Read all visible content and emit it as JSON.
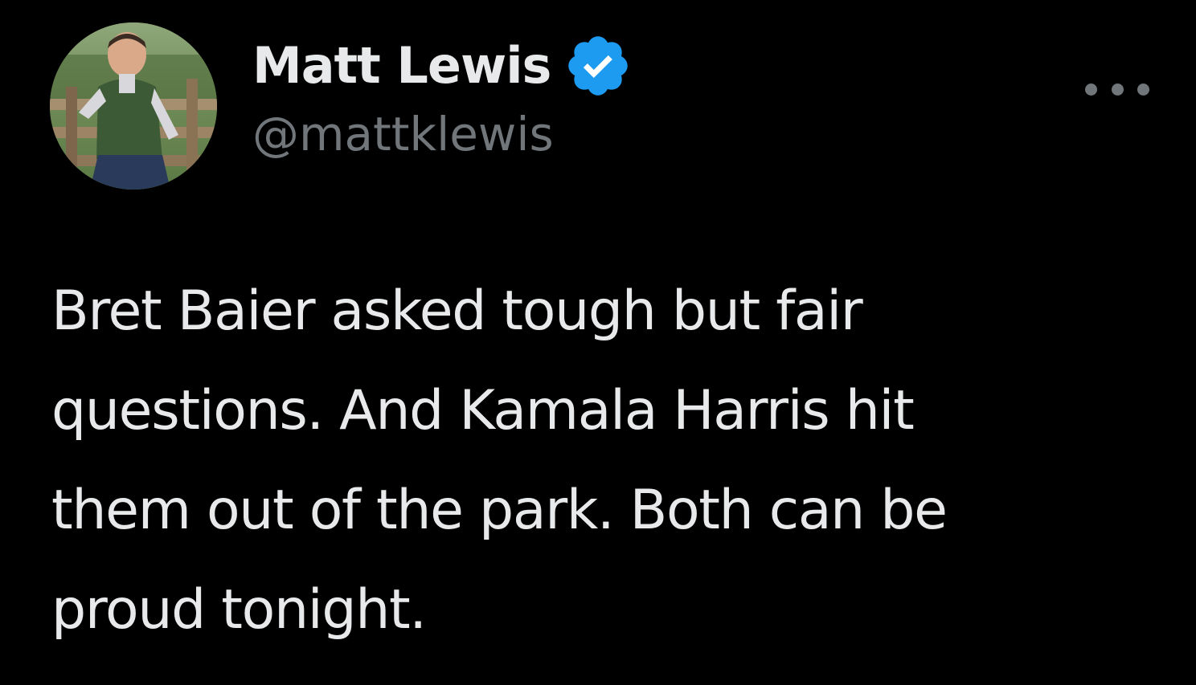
{
  "author": {
    "display_name": "Matt Lewis",
    "handle": "@mattklewis",
    "verified": true,
    "avatar_icon": "profile-photo",
    "badge_icon": "verified-checkmark-icon",
    "badge_color": "#1d9bf0"
  },
  "tweet": {
    "text_lines": [
      "Bret Baier asked tough but fair",
      "questions. And Kamala Harris hit",
      "them out of the park. Both can be",
      "proud tonight."
    ]
  },
  "actions": {
    "more_icon": "more-options-icon"
  },
  "colors": {
    "background": "#000000",
    "text_primary": "#e7e9ea",
    "text_secondary": "#71767b"
  }
}
